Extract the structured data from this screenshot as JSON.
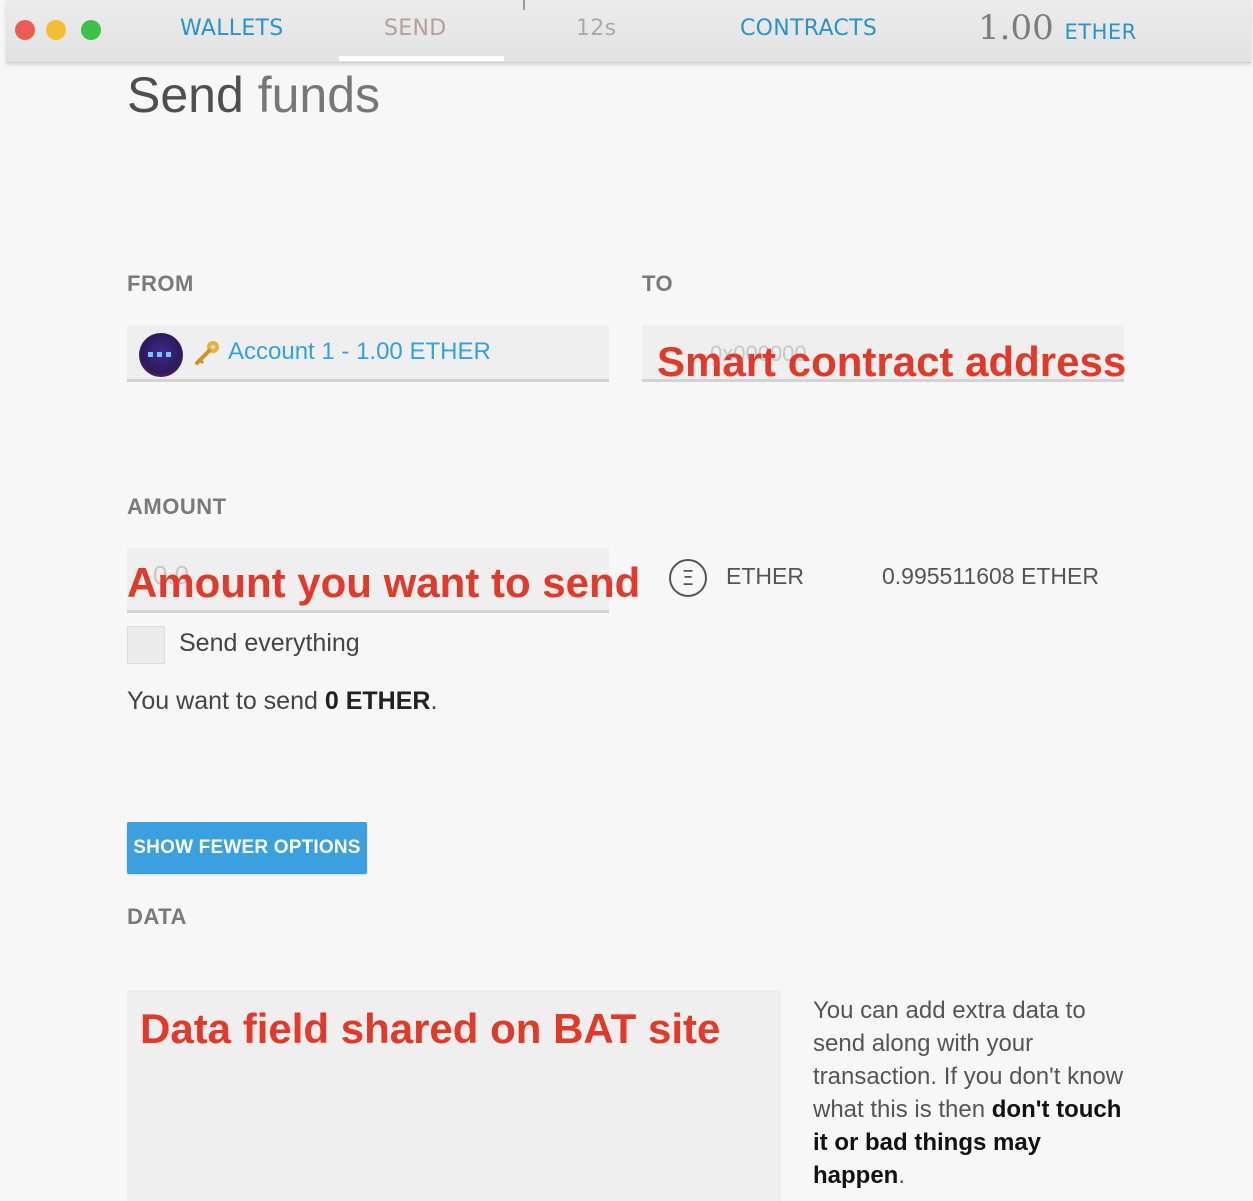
{
  "topbar": {
    "wallets": "WALLETS",
    "send": "SEND",
    "timer": "12s",
    "contracts": "CONTRACTS",
    "balance_value": "1.00",
    "balance_unit": "ETHER"
  },
  "page": {
    "title_strong": "Send",
    "title_light": "funds"
  },
  "from": {
    "label": "FROM",
    "account_text": "Account 1 - 1.00 ETHER"
  },
  "to": {
    "label": "TO",
    "placeholder": "0x000000",
    "overlay": "Smart contract address"
  },
  "amount": {
    "label": "AMOUNT",
    "placeholder": "0.0",
    "overlay": "Amount you want to send",
    "currency_symbol": "Ξ",
    "currency": "ETHER",
    "available": "0.995511608 ETHER"
  },
  "send_everything": {
    "label": "Send everything"
  },
  "summary": {
    "prefix": "You want to send",
    "amount": "0 ETHER",
    "suffix": "."
  },
  "options_button": "SHOW FEWER OPTIONS",
  "data": {
    "label": "DATA",
    "overlay": "Data field shared on BAT site",
    "help_prefix": "You can add extra data to send along with your transaction. If you don't know what this is then",
    "help_bold": "don't touch it or bad things may happen",
    "help_suffix": "."
  },
  "colors": {
    "accent": "#2a93c9",
    "button": "#3aa0e0",
    "annotation": "#e2392a"
  }
}
